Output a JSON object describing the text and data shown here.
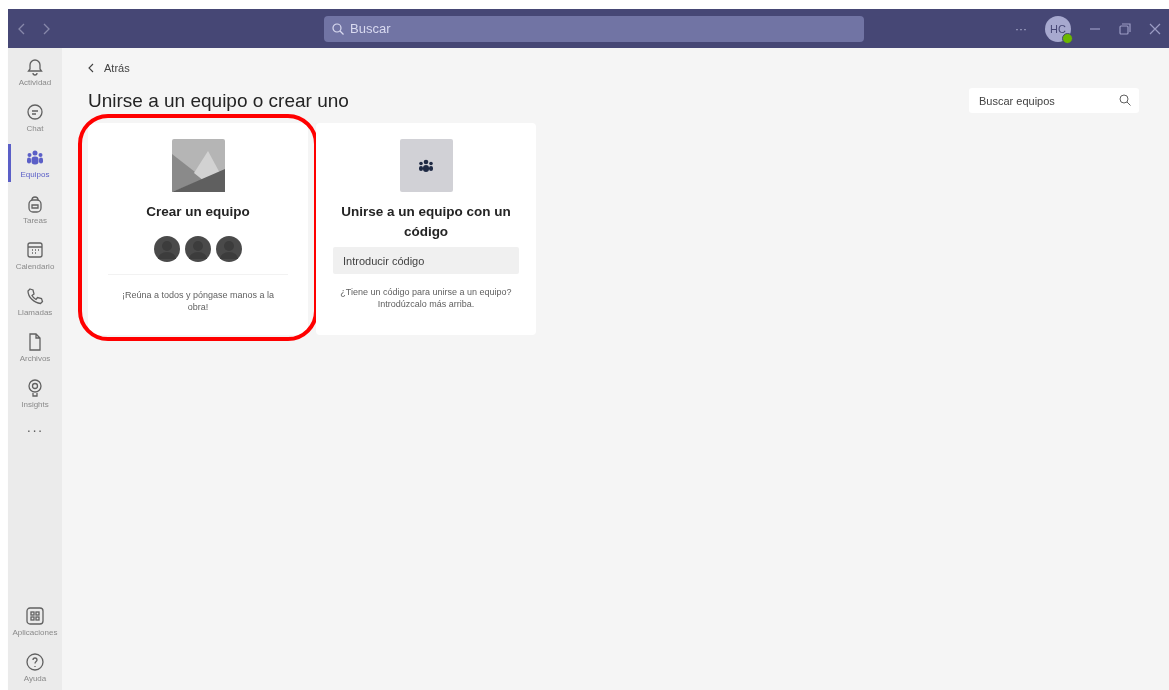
{
  "titlebar": {
    "search_placeholder": "Buscar",
    "more": "···",
    "avatar_initials": "HC"
  },
  "sidebar": {
    "items": [
      {
        "label": "Actividad",
        "kind": "bell",
        "selected": false
      },
      {
        "label": "Chat",
        "kind": "chat",
        "selected": false
      },
      {
        "label": "Equipos",
        "kind": "teams",
        "selected": true
      },
      {
        "label": "Tareas",
        "kind": "bag",
        "selected": false
      },
      {
        "label": "Calendario",
        "kind": "calendar",
        "selected": false
      },
      {
        "label": "Llamadas",
        "kind": "phone",
        "selected": false
      },
      {
        "label": "Archivos",
        "kind": "file",
        "selected": false
      },
      {
        "label": "Insights",
        "kind": "bulb",
        "selected": false
      }
    ],
    "more": "···",
    "bottom_items": [
      {
        "label": "Aplicaciones",
        "kind": "apps",
        "selected": false
      },
      {
        "label": "Ayuda",
        "kind": "help",
        "selected": false
      }
    ]
  },
  "back_link": "Atrás",
  "page_title": "Unirse a un equipo o crear uno",
  "search_teams": {
    "placeholder": "Buscar equipos"
  },
  "cards": [
    {
      "kind": "create",
      "title": "Crear un equipo",
      "description": "¡Reúna a todos y póngase manos a la obra!",
      "highlighted": true
    },
    {
      "kind": "join",
      "title": "Unirse a un equipo con un código",
      "code_field": {
        "placeholder": "Introducir código"
      },
      "description": "¿Tiene un código para unirse a un equipo? Introdúzcalo más arriba.",
      "highlighted": false
    }
  ]
}
